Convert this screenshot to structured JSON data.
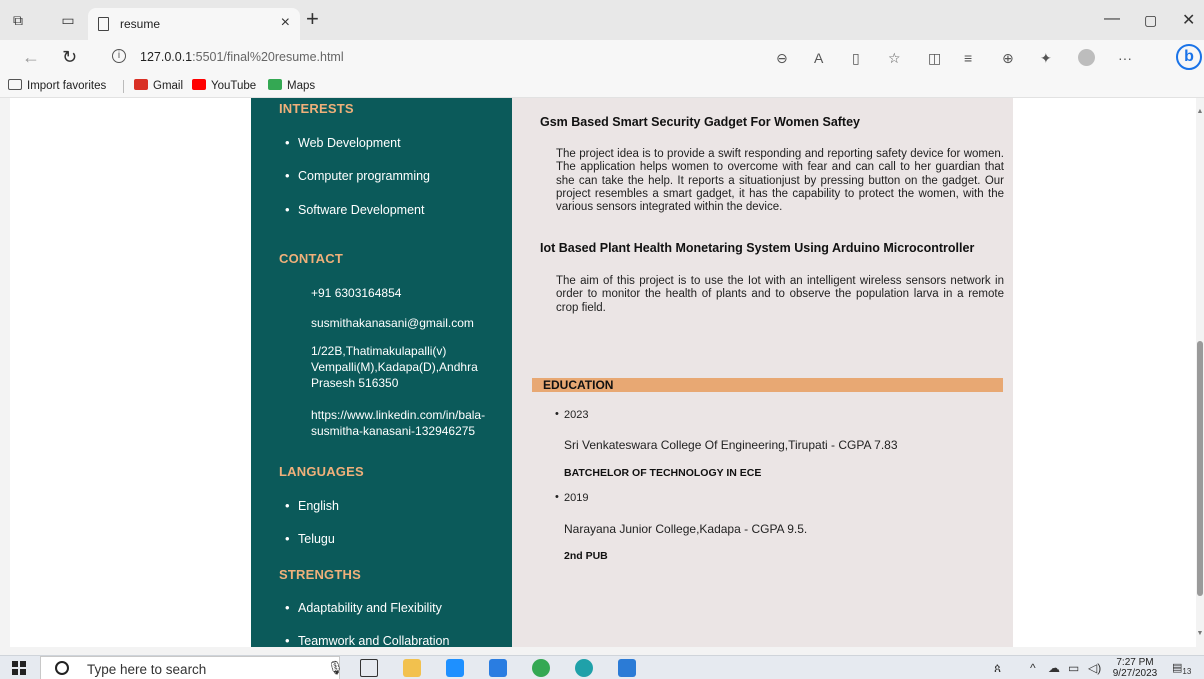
{
  "browser": {
    "tab_title": "resume",
    "tab_close": "×",
    "new_tab": "+",
    "url_host": "127.0.0.1",
    "url_rest": ":5501/final%20resume.html",
    "favorites": [
      {
        "label": "Import favorites",
        "icon": "folder-import-icon",
        "color": "#555555"
      },
      {
        "label": "Gmail",
        "icon": "gmail-icon",
        "color": "#d93025"
      },
      {
        "label": "YouTube",
        "icon": "youtube-icon",
        "color": "#ff0000"
      },
      {
        "label": "Maps",
        "icon": "maps-icon",
        "color": "#34a853"
      }
    ]
  },
  "resume": {
    "sidebar": {
      "interests_heading": "INTERESTS",
      "interests": [
        "Web Development",
        "Computer programming",
        "Software Development"
      ],
      "contact_heading": "CONTACT",
      "phone": "+91 6303164854",
      "email": "susmithakanasani@gmail.com",
      "address_1": "1/22B,Thatimakulapalli(v)",
      "address_2": "Vempalli(M),Kadapa(D),Andhra",
      "address_3": "Prasesh 516350",
      "linkedin_1": "https://www.linkedin.com/in/bala-",
      "linkedin_2": "susmitha-kanasani-132946275",
      "languages_heading": "LANGUAGES",
      "languages": [
        "English",
        "Telugu"
      ],
      "strengths_heading": "STRENGTHS",
      "strengths": [
        "Adaptability and Flexibility",
        "Teamwork and Collabration"
      ]
    },
    "projects": [
      {
        "title": "Gsm Based Smart Security Gadget For Women Saftey",
        "description": "The project idea is to provide a swift responding and reporting safety device for women. The application helps women to overcome with fear and can call to her guardian that she can take the help. It reports a situationjust by pressing button on the gadget. Our project resembles a smart gadget, it has the capability to protect the women, with the various sensors integrated within the device."
      },
      {
        "title": "Iot Based Plant Health Monetaring System Using Arduino Microcontroller",
        "description": "The aim of this project is to use the Iot with an intelligent wireless sensors network in order to monitor the health of plants and to observe the population larva in a remote crop field."
      }
    ],
    "education_heading": "EDUCATION",
    "education": [
      {
        "year": "2023",
        "institution": "Sri Venkateswara College Of Engineering,Tirupati - CGPA 7.83",
        "degree": "BATCHELOR OF TECHNOLOGY IN ECE"
      },
      {
        "year": "2019",
        "institution": "Narayana Junior College,Kadapa - CGPA 9.5.",
        "degree": "2nd PUB"
      }
    ]
  },
  "taskbar": {
    "search_placeholder": "Type here to search",
    "time": "7:27 PM",
    "date": "9/27/2023",
    "notification_count": "13"
  },
  "colors": {
    "sidebar_bg": "#0b5a5a",
    "heading_accent": "#f0b07a",
    "main_bg": "#ebe5e5",
    "education_bar": "#e8a873"
  }
}
